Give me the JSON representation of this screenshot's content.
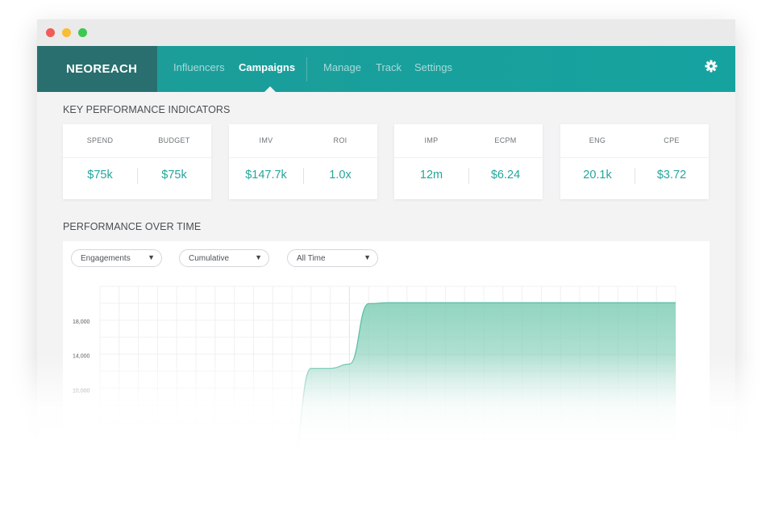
{
  "window": {
    "controls": [
      "close",
      "minimize",
      "maximize"
    ]
  },
  "brand": {
    "logo": "NEOREACH",
    "accent": "#1a9e9a",
    "value_color": "#23a69c"
  },
  "nav": {
    "items": [
      {
        "label": "Influencers",
        "active": false
      },
      {
        "label": "Campaigns",
        "active": true
      },
      {
        "label": "Manage",
        "active": false
      },
      {
        "label": "Track",
        "active": false
      },
      {
        "label": "Settings",
        "active": false
      }
    ],
    "settings_icon": "gear-icon"
  },
  "kpi": {
    "title": "KEY PERFORMANCE INDICATORS",
    "cards": [
      {
        "metrics": [
          {
            "label": "SPEND",
            "value": "$75k"
          },
          {
            "label": "BUDGET",
            "value": "$75k"
          }
        ]
      },
      {
        "metrics": [
          {
            "label": "IMV",
            "value": "$147.7k"
          },
          {
            "label": "ROI",
            "value": "1.0x"
          }
        ]
      },
      {
        "metrics": [
          {
            "label": "IMP",
            "value": "12m"
          },
          {
            "label": "ECPM",
            "value": "$6.24"
          }
        ]
      },
      {
        "metrics": [
          {
            "label": "ENG",
            "value": "20.1k"
          },
          {
            "label": "CPE",
            "value": "$3.72"
          }
        ]
      }
    ]
  },
  "performance": {
    "title": "PERFORMANCE OVER TIME",
    "filters": [
      {
        "label": "Engagements"
      },
      {
        "label": "Cumulative"
      },
      {
        "label": "All Time"
      }
    ]
  },
  "chart_data": {
    "type": "area",
    "title": "",
    "xlabel": "",
    "ylabel": "",
    "ytick_labels": [
      "18,000",
      "14,000",
      "10,000"
    ],
    "ylim": [
      2000,
      22000
    ],
    "grid": true,
    "x": [
      0,
      9,
      10,
      11,
      12,
      13,
      14,
      15,
      16,
      20,
      30
    ],
    "values": [
      null,
      null,
      0,
      12500,
      12500,
      13000,
      20000,
      20100,
      20100,
      20100,
      20100
    ],
    "color": "#7fcdb6"
  }
}
